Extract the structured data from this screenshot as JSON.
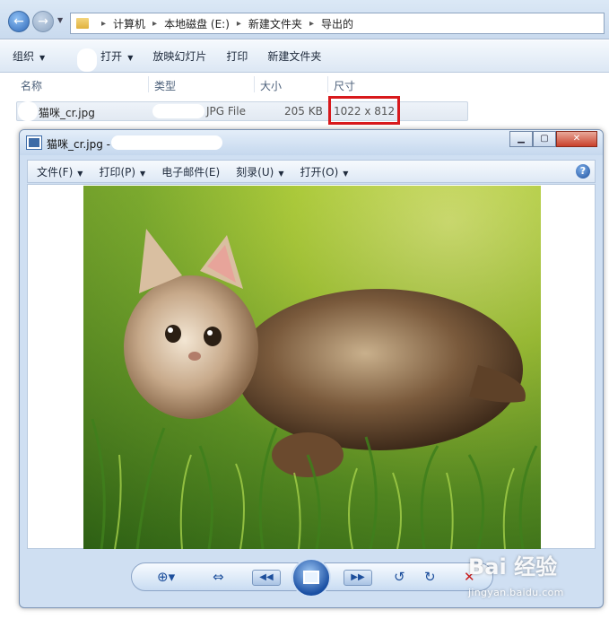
{
  "address": {
    "crumbs": [
      "计算机",
      "本地磁盘 (E:)",
      "新建文件夹",
      "导出的"
    ]
  },
  "toolbar": {
    "organize": "组织",
    "open": "打开",
    "slideshow": "放映幻灯片",
    "print": "打印",
    "new_folder": "新建文件夹"
  },
  "columns": {
    "name": "名称",
    "type": "类型",
    "size": "大小",
    "dimensions": "尺寸"
  },
  "file": {
    "name": "猫咪_cr.jpg",
    "type": "JPG File",
    "size": "205 KB",
    "dimensions": "1022 x 812"
  },
  "viewer": {
    "title": "猫咪_cr.jpg -",
    "menu": {
      "file": "文件(F)",
      "print": "打印(P)",
      "email": "电子邮件(E)",
      "burn": "刻录(U)",
      "open": "打开(O)"
    },
    "help_icon": "?"
  },
  "watermark": {
    "logo": "Bai 经验",
    "url": "jingyan.baidu.com"
  },
  "colors": {
    "highlight": "#d8191c",
    "accent": "#1d4f9c"
  }
}
